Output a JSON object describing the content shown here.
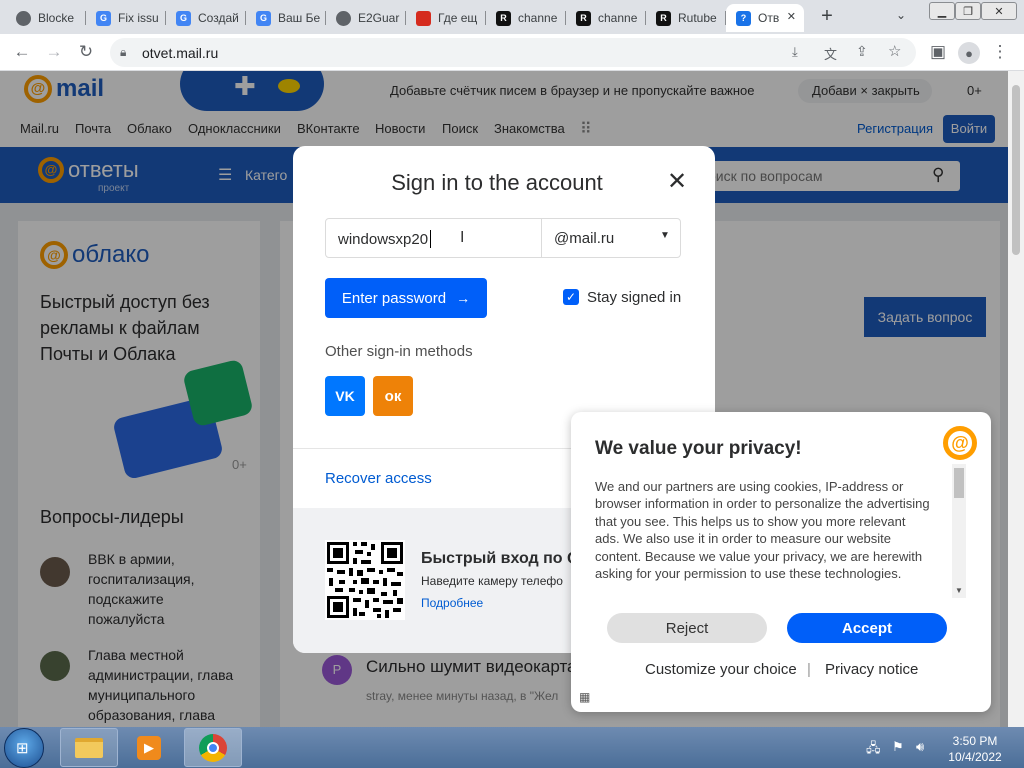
{
  "browser": {
    "tabs": [
      {
        "label": "Blocke",
        "favicon": "globe-icon",
        "fav_color": "#5f6368"
      },
      {
        "label": "Fix issu",
        "favicon": "google-icon",
        "fav_color": "#4285f4"
      },
      {
        "label": "Создай",
        "favicon": "google-icon",
        "fav_color": "#4285f4"
      },
      {
        "label": "Ваш Бе",
        "favicon": "google-icon",
        "fav_color": "#4285f4"
      },
      {
        "label": "E2Guar",
        "favicon": "globe-icon",
        "fav_color": "#5f6368"
      },
      {
        "label": "Где ещ",
        "favicon": "flag-icon",
        "fav_color": "#d52b1e"
      },
      {
        "label": "channe",
        "favicon": "rutube-icon",
        "fav_color": "#111"
      },
      {
        "label": "channe",
        "favicon": "rutube-icon",
        "fav_color": "#111"
      },
      {
        "label": "Rutube",
        "favicon": "rutube-icon",
        "fav_color": "#111"
      },
      {
        "label": "Отв",
        "favicon": "question-icon",
        "fav_color": "#1a73e8",
        "active": true
      }
    ],
    "new_tab": "+",
    "url": "otvet.mail.ru"
  },
  "page": {
    "logo": "mail",
    "promo_text": "Добавьте счётчик писем в браузер и не пропускайте важное",
    "promo_add": "Добави",
    "promo_close": "закрыть",
    "counter": "0+",
    "nav": [
      "Mail.ru",
      "Почта",
      "Облако",
      "Одноклассники",
      "ВКонтакте",
      "Новости",
      "Поиск",
      "Знакомства"
    ],
    "register": "Регистрация",
    "login_btn": "Войти",
    "otvety_logo": "ответы",
    "otvety_sub": "проект",
    "categories": "Катего",
    "search_placeholder": "оиск по вопросам",
    "cloud_logo": "облако",
    "cloud_promo": "Быстрый доступ без рекламы к файлам Почты и Облака",
    "cloud_counter": "0+",
    "leaders_title": "Вопросы-лидеры",
    "leader1": "ВВК в армии, госпитализация, подскажите пожалуйста",
    "leader2": "Глава местной администрации, глава муниципального образования, глава",
    "ask_btn": "Задать вопрос",
    "question_title": "Сильно шумит видеокарта",
    "question_meta": "stray, менее минуты назад, в \"Жел"
  },
  "modal": {
    "title": "Sign in to the account",
    "close": "✕",
    "login_value": "windowsxp20",
    "domain": "@mail.ru",
    "enter_password": "Enter password",
    "arrow": "→",
    "stay_signed": "Stay signed in",
    "other_methods": "Other sign-in methods",
    "vk": "VK",
    "ok": "ок",
    "recover": "Recover access",
    "qr_title": "Быстрый вход по Q",
    "qr_desc": "Наведите камеру телефо",
    "qr_more": "Подробнее"
  },
  "privacy": {
    "title": "We value your privacy!",
    "text": "We and our partners are using cookies, IP-address or browser information in order to personalize the advertising that you see. This helps us to show you more relevant ads. We also use it in order to measure our website content. Because we value your privacy, we are herewith asking for your permission to use these technologies.",
    "reject": "Reject",
    "accept": "Accept",
    "customize": "Customize your choice",
    "separator": "|",
    "notice": "Privacy notice"
  },
  "taskbar": {
    "time": "3:50 PM",
    "date": "10/4/2022"
  },
  "colors": {
    "accent": "#005ff9",
    "mail_blue": "#1e5cbf",
    "mail_orange": "#ff9e00",
    "ok_orange": "#ee8208"
  }
}
